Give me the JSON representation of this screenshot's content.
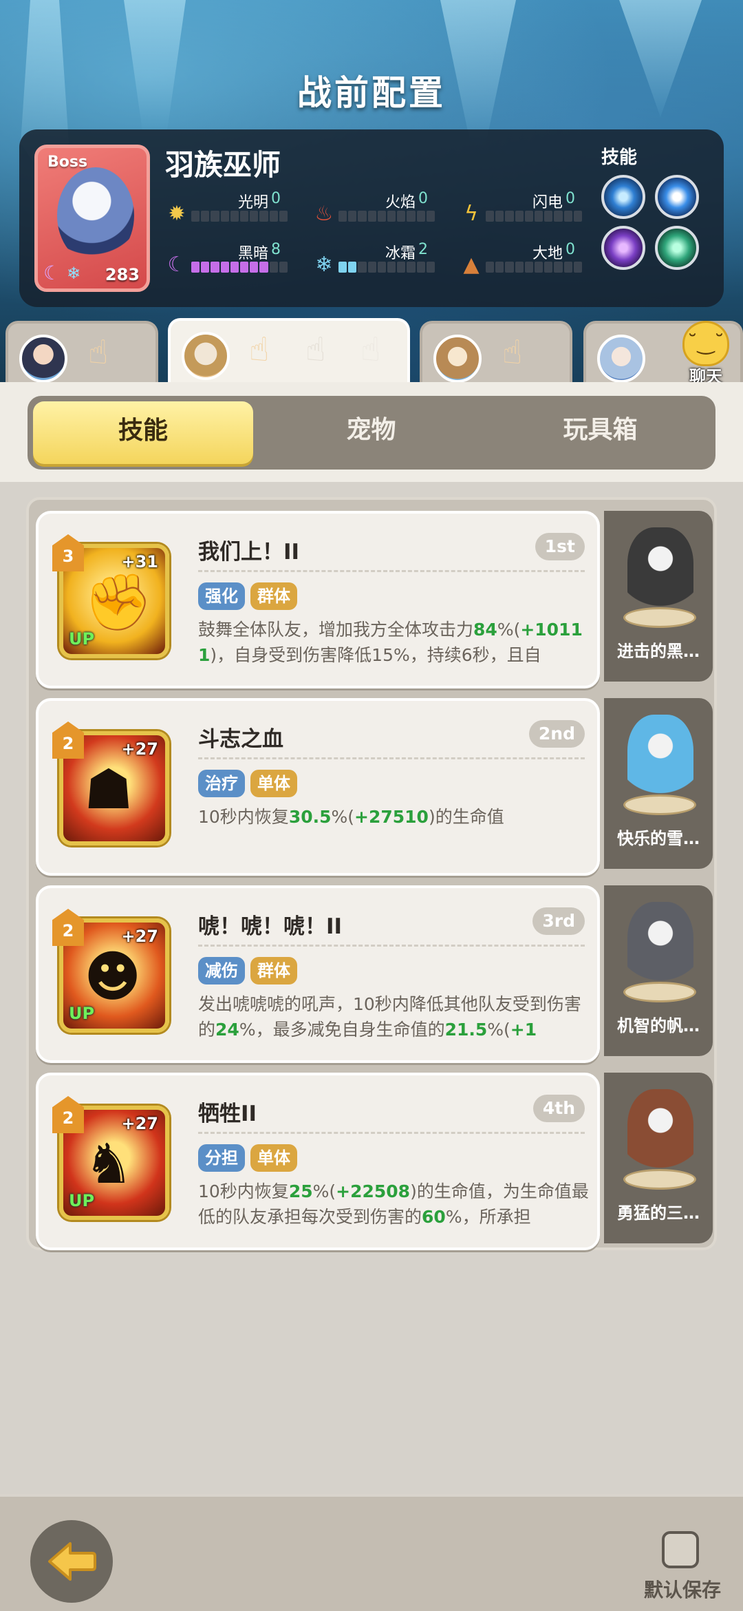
{
  "header": {
    "title": "战前配置"
  },
  "boss": {
    "tag": "Boss",
    "name": "羽族巫师",
    "level": "283",
    "skills_label": "技能",
    "stats": [
      {
        "label": "光明",
        "value": "0",
        "filled": 0,
        "icon": "sun-icon",
        "color": "#f2c84b"
      },
      {
        "label": "火焰",
        "value": "0",
        "filled": 0,
        "icon": "flame-icon",
        "color": "#e0513a"
      },
      {
        "label": "闪电",
        "value": "0",
        "filled": 0,
        "icon": "lightning-icon",
        "color": "#f5c43a"
      },
      {
        "label": "黑暗",
        "value": "8",
        "filled": 8,
        "icon": "moon-icon",
        "color": "#c56ee8"
      },
      {
        "label": "冰霜",
        "value": "2",
        "filled": 2,
        "icon": "snowflake-icon",
        "color": "#7fd3f0"
      },
      {
        "label": "大地",
        "value": "0",
        "filled": 0,
        "icon": "mountain-icon",
        "color": "#d8803a"
      }
    ]
  },
  "team": {
    "chat_label": "聊天"
  },
  "tabs": {
    "skills": "技能",
    "pets": "宠物",
    "toybox": "玩具箱",
    "active": "skills"
  },
  "skills": [
    {
      "level": "3",
      "plus": "+31",
      "up": "UP",
      "title": "我们上！II",
      "rank": "1st",
      "tags": [
        "强化",
        "群体"
      ],
      "desc_parts": [
        {
          "t": "鼓舞全体队友，增加我方全体攻击力"
        },
        {
          "t": "84",
          "g": true
        },
        {
          "t": "%("
        },
        {
          "t": "+10111",
          "g": true
        },
        {
          "t": ")，自身受到伤害降低15%，持续6秒，且自"
        }
      ],
      "pet": {
        "name": "进击的黑…"
      },
      "colors": {
        "icon_bg": "#f1b21f",
        "pet": "#3a3a3a"
      }
    },
    {
      "level": "2",
      "plus": "+27",
      "up": "",
      "title": "斗志之血",
      "rank": "2nd",
      "tags": [
        "治疗",
        "单体"
      ],
      "desc_parts": [
        {
          "t": "10秒内恢复"
        },
        {
          "t": "30.5",
          "g": true
        },
        {
          "t": "%("
        },
        {
          "t": "+27510",
          "g": true
        },
        {
          "t": ")的生命值"
        }
      ],
      "pet": {
        "name": "快乐的雪…"
      },
      "colors": {
        "icon_bg": "#d23a1d",
        "pet": "#5fb7e6"
      }
    },
    {
      "level": "2",
      "plus": "+27",
      "up": "UP",
      "title": "唬！唬！唬！II",
      "rank": "3rd",
      "tags": [
        "减伤",
        "群体"
      ],
      "desc_parts": [
        {
          "t": "发出唬唬唬的吼声，10秒内降低其他队友受到伤害的"
        },
        {
          "t": "24",
          "g": true
        },
        {
          "t": "%，最多减免自身生命值的"
        },
        {
          "t": "21.5",
          "g": true
        },
        {
          "t": "%("
        },
        {
          "t": "+1",
          "g": true
        }
      ],
      "pet": {
        "name": "机智的帆…"
      },
      "colors": {
        "icon_bg": "#e0591e",
        "pet": "#5d5f66"
      }
    },
    {
      "level": "2",
      "plus": "+27",
      "up": "UP",
      "title": "牺牲II",
      "rank": "4th",
      "tags": [
        "分担",
        "单体"
      ],
      "desc_parts": [
        {
          "t": "10秒内恢复"
        },
        {
          "t": "25",
          "g": true
        },
        {
          "t": "%("
        },
        {
          "t": "+22508",
          "g": true
        },
        {
          "t": ")的生命值，为生命值最低的队友承担每次受到伤害的"
        },
        {
          "t": "60",
          "g": true
        },
        {
          "t": "%，所承担"
        }
      ],
      "pet": {
        "name": "勇猛的三…"
      },
      "colors": {
        "icon_bg": "#d1341b",
        "pet": "#8a4d34"
      }
    }
  ],
  "footer": {
    "save_label": "默认保存"
  }
}
